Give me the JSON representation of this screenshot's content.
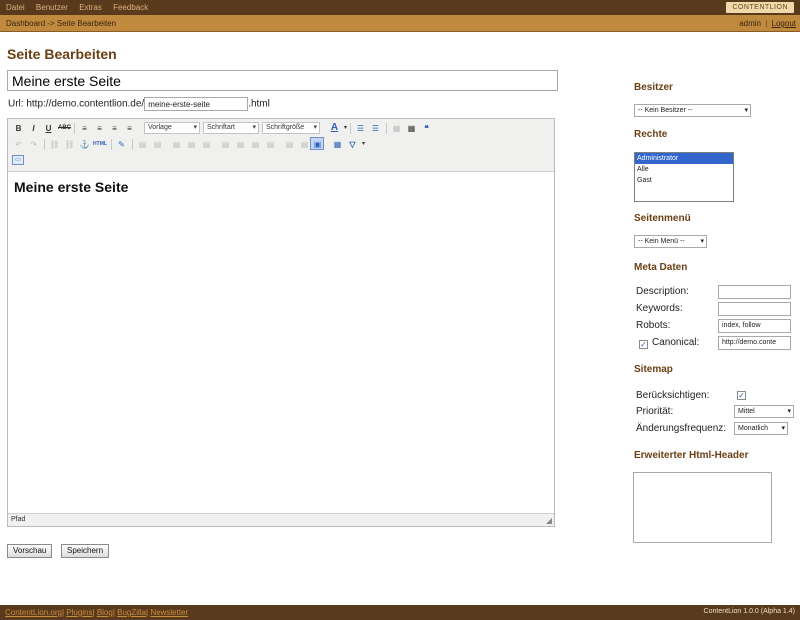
{
  "nav": {
    "items": [
      "Datei",
      "Benutzer",
      "Extras",
      "Feedback"
    ],
    "logo": "CONTENTLION"
  },
  "breadcrumb": "Dashboard -> Seite Bearbeiten",
  "user": {
    "name": "admin",
    "separator": "|",
    "logout": "Logout"
  },
  "page_title": "Seite Bearbeiten",
  "title_value": "Meine erste Seite",
  "url": {
    "prefix": "Url: http://demo.contentlion.de/",
    "slug": "meine-erste-seite",
    "suffix": ".html"
  },
  "toolbar": {
    "row1": [
      "B",
      "I",
      "U",
      "ABC",
      "≡",
      "≡",
      "≡",
      "≡",
      "A",
      "☰",
      "☰",
      "▦",
      "▦",
      "❝"
    ],
    "format_select": "Vorlage",
    "font_select": "Schriftart",
    "size_select": "Schriftgröße",
    "row2": [
      "↶",
      "↷",
      "⛓",
      "⛓",
      "⚓",
      "HTML",
      "✎",
      "▤",
      "▤",
      "▤",
      "▤",
      "▤",
      "▤",
      "▤",
      "▤",
      "▤",
      "▤",
      "▤",
      "▣",
      "▦",
      "▽"
    ]
  },
  "editor_heading": "Meine erste Seite",
  "editor_path": "Pfad",
  "buttons": {
    "preview": "Vorschau",
    "save": "Speichern"
  },
  "sidebar": {
    "owner_heading": "Besitzer",
    "owner_select": "-- Kein Besitzer --",
    "rights_heading": "Rechte",
    "rights": [
      "Administrator",
      "Alle",
      "Gast"
    ],
    "rights_selected": "Administrator",
    "menu_heading": "Seitenmenü",
    "menu_select": "-- Kein Menü --",
    "meta_heading": "Meta Daten",
    "meta": {
      "description_label": "Description:",
      "description_value": "",
      "keywords_label": "Keywords:",
      "keywords_value": "",
      "robots_label": "Robots:",
      "robots_value": "index, follow",
      "canonical_label": "Canonical:",
      "canonical_checked": true,
      "canonical_value": "http://demo.conte"
    },
    "sitemap_heading": "Sitemap",
    "sitemap": {
      "consider_label": "Berücksichtigen:",
      "consider_checked": true,
      "priority_label": "Priorität:",
      "priority_value": "Mittel",
      "frequency_label": "Änderungsfrequenz:",
      "frequency_value": "Monatlich"
    },
    "html_header_heading": "Erweiterter Html-Header",
    "html_header_value": ""
  },
  "footer": {
    "links": [
      "ContentLion.org",
      "Plugins",
      "Blog",
      "BugZilla",
      "Newsletter"
    ],
    "version": "ContentLion 1.0.0 (Alpha 1.4)"
  }
}
